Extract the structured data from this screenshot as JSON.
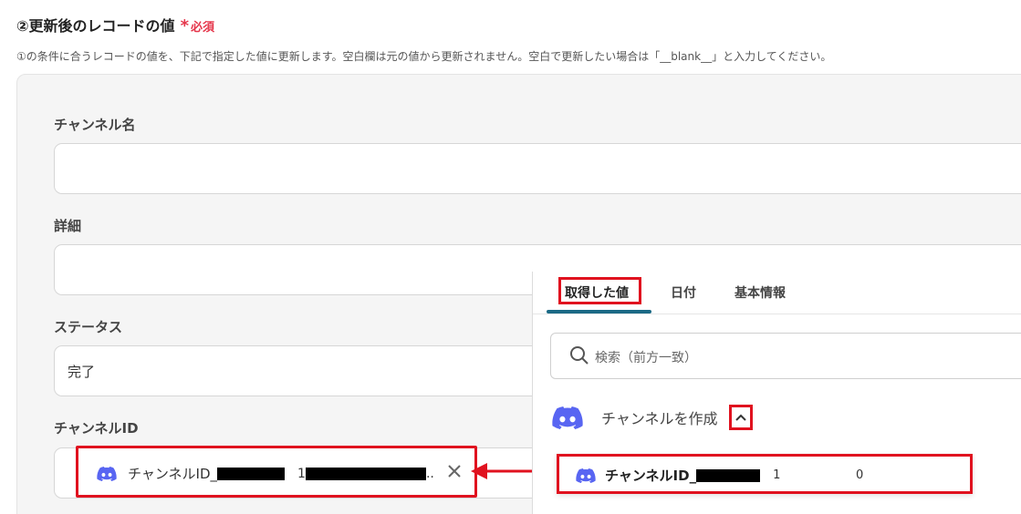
{
  "section": {
    "title": "②更新後のレコードの値",
    "required_star": "*",
    "required_text": "必須",
    "description": "①の条件に合うレコードの値を、下記で指定した値に更新します。空白欄は元の値から更新されません。空白で更新したい場合は「__blank__」と入力してください。"
  },
  "fields": {
    "channel_name": {
      "label": "チャンネル名",
      "value": ""
    },
    "detail": {
      "label": "詳細",
      "value": ""
    },
    "status": {
      "label": "ステータス",
      "value": "完了"
    },
    "channel_id": {
      "label": "チャンネルID"
    }
  },
  "chip": {
    "text": "チャンネルID_",
    "num_prefix": "1",
    "ellipsis": ".."
  },
  "dropdown": {
    "tabs": [
      {
        "label": "取得した値",
        "active": true
      },
      {
        "label": "日付",
        "active": false
      },
      {
        "label": "基本情報",
        "active": false
      }
    ],
    "search_placeholder": "検索（前方一致）",
    "group_label": "チャンネルを作成",
    "option": {
      "text": "チャンネルID_",
      "num": "1                    0"
    }
  },
  "colors": {
    "highlight": "#e0121f",
    "discord": "#5865f2",
    "tab_underline": "#1b6a86",
    "required": "#e5364b"
  },
  "icons": {
    "discord": "discord-icon",
    "close": "close-icon",
    "search": "search-icon",
    "chevron": "chevron-up-icon",
    "arrow": "arrow-left-icon"
  }
}
